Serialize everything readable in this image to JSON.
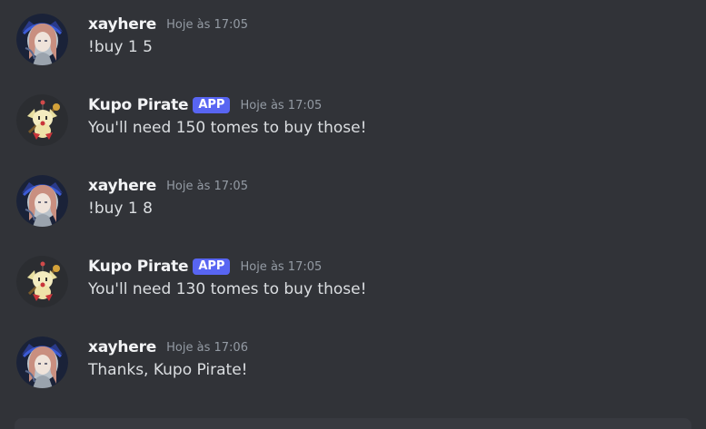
{
  "messages": [
    {
      "author": "xayhere",
      "is_app": false,
      "badge": "",
      "timestamp": "Hoje às 17:05",
      "content": "!buy 1 5",
      "avatar_icon": "anime-girl-avatar-icon"
    },
    {
      "author": "Kupo Pirate",
      "is_app": true,
      "badge": "APP",
      "timestamp": "Hoje às 17:05",
      "content": "You'll need 150 tomes to buy those!",
      "avatar_icon": "moogle-avatar-icon"
    },
    {
      "author": "xayhere",
      "is_app": false,
      "badge": "",
      "timestamp": "Hoje às 17:05",
      "content": "!buy 1 8",
      "avatar_icon": "anime-girl-avatar-icon"
    },
    {
      "author": "Kupo Pirate",
      "is_app": true,
      "badge": "APP",
      "timestamp": "Hoje às 17:05",
      "content": "You'll need 130 tomes to buy those!",
      "avatar_icon": "moogle-avatar-icon"
    },
    {
      "author": "xayhere",
      "is_app": false,
      "badge": "",
      "timestamp": "Hoje às 17:06",
      "content": "Thanks, Kupo Pirate!",
      "avatar_icon": "anime-girl-avatar-icon"
    }
  ],
  "colors": {
    "background": "#313338",
    "app_badge": "#5865f2",
    "username": "#f2f3f5",
    "timestamp": "#949ba4",
    "message_text": "#dbdee1"
  }
}
